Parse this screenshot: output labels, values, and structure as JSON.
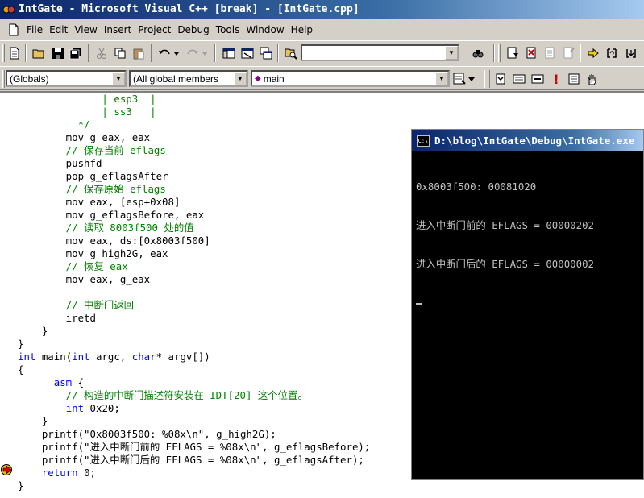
{
  "window": {
    "title": "IntGate - Microsoft Visual C++ [break] - [IntGate.cpp]"
  },
  "menu": [
    "File",
    "Edit",
    "View",
    "Insert",
    "Project",
    "Debug",
    "Tools",
    "Window",
    "Help"
  ],
  "toolbar": {
    "find_combo_value": "",
    "icons": [
      "new-file-icon",
      "open-icon",
      "save-icon",
      "save-all-icon",
      "cut-icon",
      "copy-icon",
      "paste-icon",
      "undo-icon",
      "redo-icon",
      "workspace-icon",
      "output-icon",
      "window-list-icon",
      "find-in-files-icon",
      "find-icon",
      "compile-icon",
      "build-icon",
      "stop-build-icon",
      "execute-icon",
      "go-icon",
      "insert-breakpoint-icon",
      "step-into-icon",
      "step-over-icon"
    ]
  },
  "wizardbar": {
    "class_combo": "(Globals)",
    "filter_combo": "(All global members",
    "member_combo": "main",
    "icons": [
      "wizard-action-icon",
      "go-icon",
      "build-icon",
      "compile-icon",
      "stop-icon",
      "breakpoint-list-icon",
      "hand-icon"
    ]
  },
  "code_lines": [
    [
      {
        "t": "              | esp3  |",
        "c": "cm"
      }
    ],
    [
      {
        "t": "              | ss3   |",
        "c": "cm"
      }
    ],
    [
      {
        "t": "          */",
        "c": "cm"
      }
    ],
    [
      {
        "t": "        mov g_eax, eax",
        "c": ""
      }
    ],
    [
      {
        "t": "        // 保存当前 eflags",
        "c": "cm"
      }
    ],
    [
      {
        "t": "        pushfd",
        "c": ""
      }
    ],
    [
      {
        "t": "        pop g_eflagsAfter",
        "c": ""
      }
    ],
    [
      {
        "t": "        // 保存原始 eflags",
        "c": "cm"
      }
    ],
    [
      {
        "t": "        mov eax, [esp+0x08]",
        "c": ""
      }
    ],
    [
      {
        "t": "        mov g_eflagsBefore, eax",
        "c": ""
      }
    ],
    [
      {
        "t": "        // 读取 8003f500 处的值",
        "c": "cm"
      }
    ],
    [
      {
        "t": "        mov eax, ds:[0x8003f500]",
        "c": ""
      }
    ],
    [
      {
        "t": "        mov g_high2G, eax",
        "c": ""
      }
    ],
    [
      {
        "t": "        // 恢复 eax",
        "c": "cm"
      }
    ],
    [
      {
        "t": "        mov eax, g_eax",
        "c": ""
      }
    ],
    [
      {
        "t": "",
        "c": ""
      }
    ],
    [
      {
        "t": "        // 中断门返回",
        "c": "cm"
      }
    ],
    [
      {
        "t": "        iretd",
        "c": ""
      }
    ],
    [
      {
        "t": "    }",
        "c": ""
      }
    ],
    [
      {
        "t": "}",
        "c": ""
      }
    ],
    [
      {
        "t": "int",
        "c": "kw"
      },
      {
        "t": " main(",
        "c": ""
      },
      {
        "t": "int",
        "c": "kw"
      },
      {
        "t": " argc, ",
        "c": ""
      },
      {
        "t": "char",
        "c": "kw"
      },
      {
        "t": "* argv[])",
        "c": ""
      }
    ],
    [
      {
        "t": "{",
        "c": ""
      }
    ],
    [
      {
        "t": "    ",
        "c": ""
      },
      {
        "t": "__asm",
        "c": "kw"
      },
      {
        "t": " {",
        "c": ""
      }
    ],
    [
      {
        "t": "        // 构造的中断门描述符安装在 IDT[20] 这个位置。",
        "c": "cm"
      }
    ],
    [
      {
        "t": "        ",
        "c": ""
      },
      {
        "t": "int",
        "c": "kw"
      },
      {
        "t": " 0x20;",
        "c": ""
      }
    ],
    [
      {
        "t": "    }",
        "c": ""
      }
    ],
    [
      {
        "t": "    printf(\"0x8003f500: %08x\\n\", g_high2G);",
        "c": ""
      }
    ],
    [
      {
        "t": "    printf(\"进入中断门前的 EFLAGS = %08x\\n\", g_eflagsBefore);",
        "c": ""
      }
    ],
    [
      {
        "t": "    printf(\"进入中断门后的 EFLAGS = %08x\\n\", g_eflagsAfter);",
        "c": ""
      }
    ],
    [
      {
        "t": "    ",
        "c": ""
      },
      {
        "t": "return",
        "c": "kw"
      },
      {
        "t": " 0;",
        "c": ""
      }
    ],
    [
      {
        "t": "}",
        "c": ""
      }
    ]
  ],
  "console": {
    "title": "D:\\blog\\IntGate\\Debug\\IntGate.exe",
    "icon_label": "C:\\",
    "lines": [
      "0x8003f500: 00081020",
      "进入中断门前的 EFLAGS = 00000202",
      "进入中断门后的 EFLAGS = 00000002"
    ]
  },
  "colors": {
    "keyword": "#0000ff",
    "comment": "#008000",
    "title_bar": "#0a246a",
    "console_text": "#c0c0c0"
  }
}
